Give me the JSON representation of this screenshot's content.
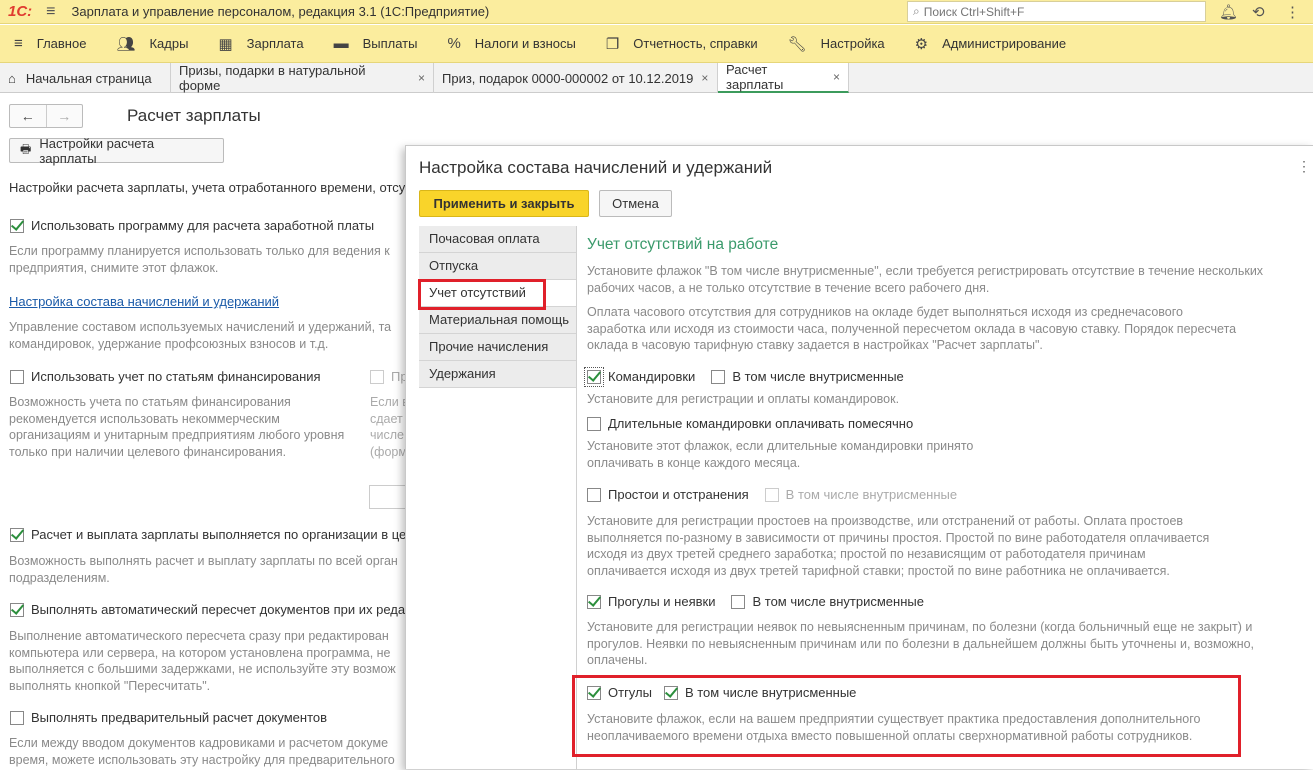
{
  "app": {
    "logo": "1С:",
    "title": "Зарплата и управление персоналом, редакция 3.1  (1С:Предприятие)",
    "search_placeholder": "Поиск Ctrl+Shift+F"
  },
  "menu": [
    {
      "icon": "menu-icon",
      "glyph": "≡",
      "label": "Главное"
    },
    {
      "icon": "people-icon",
      "glyph": "👥",
      "label": "Кадры"
    },
    {
      "icon": "calculator-icon",
      "glyph": "▦",
      "label": "Зарплата"
    },
    {
      "icon": "wallet-icon",
      "glyph": "▬",
      "label": "Выплаты"
    },
    {
      "icon": "percent-icon",
      "glyph": "%",
      "label": "Налоги и взносы"
    },
    {
      "icon": "reports-icon",
      "glyph": "❐",
      "label": "Отчетность, справки"
    },
    {
      "icon": "wrench-icon",
      "glyph": "🔧",
      "label": "Настройка"
    },
    {
      "icon": "gear-icon",
      "glyph": "⚙",
      "label": "Администрирование"
    }
  ],
  "tabs": [
    {
      "label": "Начальная страница",
      "home": true
    },
    {
      "label": "Призы, подарки в натуральной форме",
      "close": "×"
    },
    {
      "label": "Приз, подарок 0000-000002 от 10.12.2019",
      "close": "×"
    },
    {
      "label": "Расчет зарплаты",
      "close": "×",
      "active": true
    }
  ],
  "page": {
    "nav_back": "←",
    "nav_forward": "→",
    "title": "Расчет зарплаты",
    "settings_button": "Настройки расчета зарплаты",
    "intro": "Настройки расчета зарплаты, учета отработанного времени, отсут",
    "use_program_label": "Использовать программу для расчета заработной платы",
    "use_program_hint": "Если программу планируется использовать только для ведения к\nпредприятия, снимите этот флажок.",
    "link": "Настройка состава начислений и удержаний",
    "link_hint": "Управление составом используемых начислений и удержаний, та\nкомандировок, удержание профсоюзных взносов и т.д.",
    "financing_label": "Использовать учет по статьям финансирования",
    "financing_hint": "Возможность учета по статьям финансирования\nрекомендуется использовать некоммерческим\nорганизациям и унитарным предприятиям любого уровня\nтолько при наличии целевого финансирования.",
    "financing_right_label": "Пр",
    "financing_right_hint": "Если в\nсдает\nчисле\n(форм",
    "org_calc_label": "Расчет и выплата зарплаты выполняется по организации в цел",
    "org_calc_hint": "Возможность выполнять расчет и выплату зарплаты по всей орган\nподразделениям.",
    "auto_recalc_label": "Выполнять автоматический пересчет документов при их реда",
    "auto_recalc_hint": "Выполнение автоматического пересчета сразу при редактирован\nкомпьютера или сервера, на котором установлена программа, не\nвыполняется с большими задержками, не используйте эту возмож\nвыполнять кнопкой \"Пересчитать\".",
    "prelim_label": "Выполнять предварительный расчет документов",
    "prelim_hint": "Если между вводом документов кадровиками и расчетом докуме\nвремя, можете использовать эту настройку для предварительного"
  },
  "dialog": {
    "title": "Настройка состава начислений и удержаний",
    "more": "⋮",
    "apply_button": "Применить и закрыть",
    "cancel_button": "Отмена",
    "sections": [
      "Почасовая оплата",
      "Отпуска",
      "Учет отсутствий",
      "Материальная помощь",
      "Прочие начисления",
      "Удержания"
    ],
    "active_section": "Учет отсутствий",
    "section_title": "Учет отсутствий на работе",
    "p1": "Установите флажок \"В том числе внутрисменные\", если требуется регистрировать отсутствие в течение нескольких\nрабочих часов, а не только отсутствие в течение всего рабочего дня.",
    "p2": "Оплата часового отсутствия для сотрудников на окладе будет выполняться исходя из среднечасового\nзаработка или исходя из стоимости часа, полученной пересчетом оклада в часовую ставку. Порядок пересчета\nоклада в часовую тарифную ставку задается в настройках \"Расчет зарплаты\".",
    "trips_label": "Командировки",
    "trips_intra_label": "В том числе внутрисменные",
    "trips_hint": "Установите для регистрации и оплаты командировок.",
    "long_trips_label": "Длительные командировки оплачивать помесячно",
    "long_trips_hint": "Установите этот флажок, если длительные командировки принято\nоплачивать в конце каждого месяца.",
    "downtime_label": "Простои и отстранения",
    "downtime_intra_label": "В том числе внутрисменные",
    "downtime_hint": "Установите для регистрации простоев на производстве, или отстранений от работы. Оплата простоев\nвыполняется по-разному в зависимости от причины простоя. Простой по вине работодателя оплачивается\nисходя из двух третей среднего заработка; простой по независящим от работодателя причинам\nоплачивается исходя из двух третей тарифной ставки; простой по вине работника не оплачивается.",
    "absence_label": "Прогулы и неявки",
    "absence_intra_label": "В том числе внутрисменные",
    "absence_hint": "Установите для регистрации неявок по невыясненным причинам, по болезни (когда больничный еще не закрыт) и\nпрогулов. Неявки по невыясненным причинам или по болезни в дальнейшем должны быть уточнены и, возможно,\nоплачены.",
    "dayoff_label": "Отгулы",
    "dayoff_intra_label": "В том числе внутрисменные",
    "dayoff_hint": "Установите флажок, если на вашем предприятии существует практика предоставления дополнительного\nнеоплачиваемого времени отдыха вместо повышенной оплаты сверхнормативной работы сотрудников."
  },
  "colors": {
    "accent_yellow": "#f9d42a",
    "highlight_red": "#e0202a",
    "section_green": "#3a9a6b",
    "link_blue": "#1a5aa8"
  }
}
